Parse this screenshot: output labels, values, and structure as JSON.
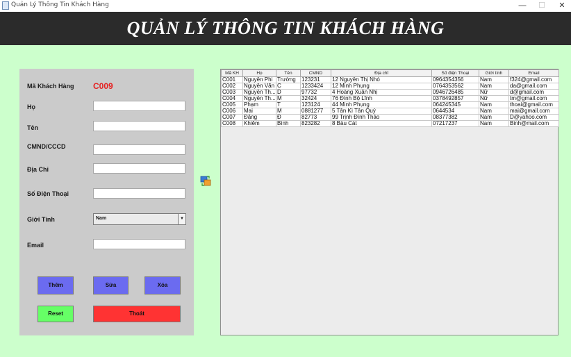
{
  "window": {
    "title": "Quản Lý Thông Tin Khách Hàng",
    "minimize": "—",
    "maximize": "☐",
    "close": "✕"
  },
  "header": {
    "title": "QUẢN LÝ THÔNG TIN KHÁCH HÀNG"
  },
  "form": {
    "labels": {
      "ma": "Mã Khách Hàng",
      "ho": "Họ",
      "ten": "Tên",
      "cmnd": "CMND/CCCD",
      "diachi": "Địa Chỉ",
      "sdt": "Số Điện Thoại",
      "gioitinh": "Giới Tính",
      "email": "Email"
    },
    "ma_value": "C009",
    "values": {
      "ho": "",
      "ten": "",
      "cmnd": "",
      "diachi": "",
      "sdt": "",
      "email": ""
    },
    "gioitinh_selected": "Nam",
    "buttons": {
      "them": "Thêm",
      "sua": "Sửa",
      "xoa": "Xóa",
      "reset": "Reset",
      "thoat": "Thoát"
    }
  },
  "colors": {
    "background": "#ccffcc",
    "header": "#2b2b2b",
    "code": "#e52222",
    "blue_button": "#6b6bf0",
    "reset_button": "#66ff66",
    "exit_button": "#ff3333"
  },
  "icons": {
    "swap": "transfer-icon"
  },
  "table": {
    "columns": [
      "Mã KH",
      "Họ",
      "Tên",
      "CMND",
      "Địa chỉ",
      "Số điện Thoại",
      "Giới tính",
      "Email"
    ],
    "rows": [
      [
        "C001",
        "Nguyễn Phi",
        "Trường",
        "123231",
        "12 Nguyễn Thị Nhỏ",
        "0964354356",
        "Nam",
        "f324@gmail.com"
      ],
      [
        "C002",
        "Nguyễn Văn",
        "C",
        "1233424",
        "12 Minh Phụng",
        "0764353562",
        "Nam",
        "da@gmail.com"
      ],
      [
        "C003",
        "Nguyễn Th...",
        "D",
        "97732",
        "4 Hoàng Xuân Nhị",
        "0946726485",
        "Nữ",
        "d@gmail.com"
      ],
      [
        "C004",
        "Nguyễn Th...",
        "M",
        "32424",
        "76 Đình Bộ Lĩnh",
        "0378492857",
        "Nữ",
        "tm@gmail.com"
      ],
      [
        "C005",
        "Phạm",
        "T",
        "123124",
        "44 Minh Phụng",
        "064245345",
        "Nam",
        "thoai@gmail.com"
      ],
      [
        "C006",
        "Mai",
        "M",
        "0881277",
        "5 Tân Kì Tân Quý",
        "0644534",
        "Nam",
        "mai@gmail.com"
      ],
      [
        "C007",
        "Đặng",
        "Đ",
        "82773",
        "99 Trịnh Đình Thảo",
        "08377382",
        "Nam",
        "D@yahoo.com"
      ],
      [
        "C008",
        "Khiêm",
        "Bình",
        "823282",
        "8 Bàu Cát",
        "07217237",
        "Nam",
        "Binh@mail.com"
      ]
    ]
  }
}
